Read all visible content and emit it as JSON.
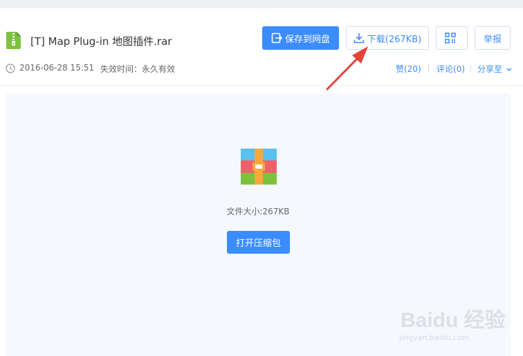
{
  "file": {
    "name": "[T] Map Plug-in 地图插件.rar",
    "date": "2016-06-28 15:51",
    "expiry": "失效时间：永久有效",
    "size_text": "文件大小:267KB"
  },
  "toolbar": {
    "save_label": "保存到网盘",
    "download_label": "下载(267KB)",
    "report_label": "举报"
  },
  "social": {
    "like_label": "赞(20)",
    "comment_label": "评论(0)",
    "share_label": "分享至"
  },
  "preview": {
    "open_label": "打开压缩包"
  },
  "watermark": {
    "brand": "Baidu 经验",
    "url": "jingyan.baidu.com"
  },
  "colors": {
    "accent": "#3b8cff",
    "file_icon": "#7cc23f",
    "arrow": "#e8423a"
  }
}
